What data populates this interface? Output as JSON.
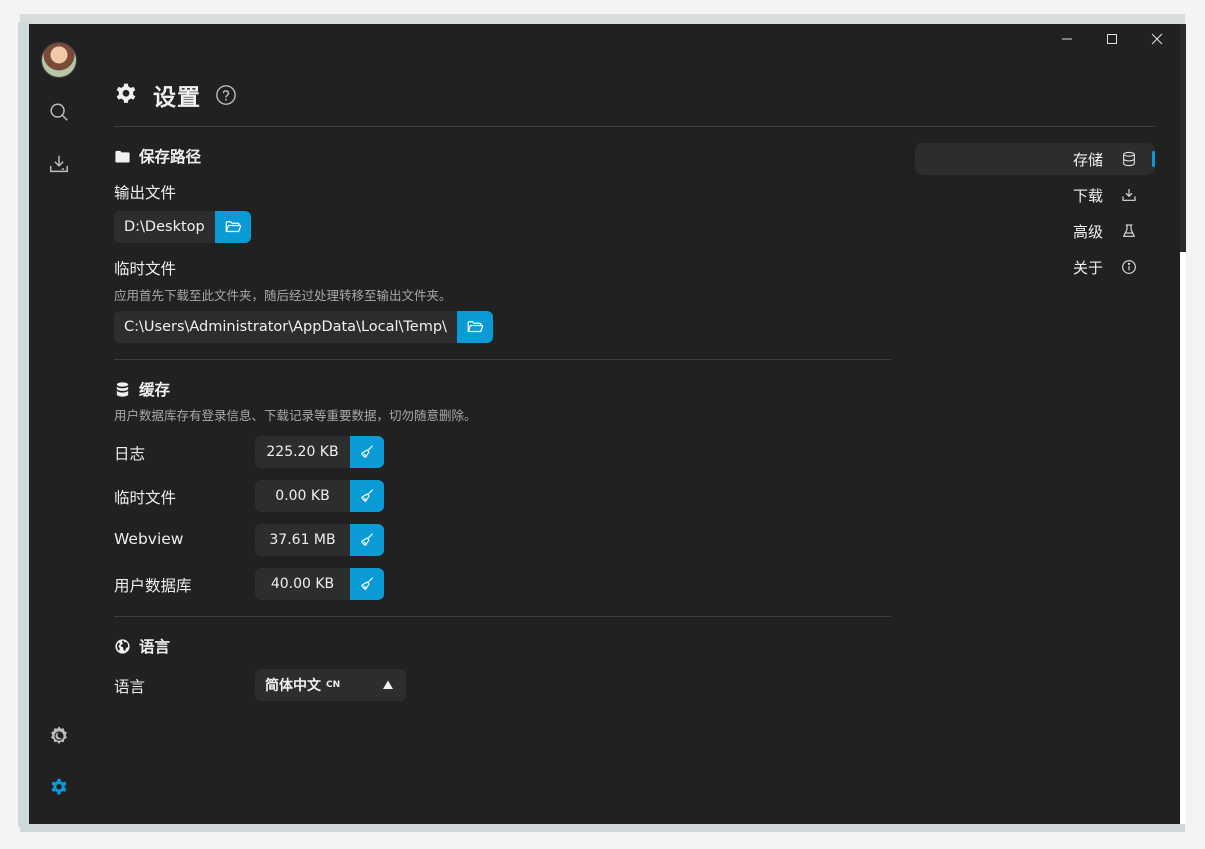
{
  "window": {
    "controls": [
      "minimize",
      "maximize",
      "close"
    ]
  },
  "rail": {
    "items": [
      "avatar",
      "search-icon",
      "download-icon",
      "theme-icon",
      "settings-icon"
    ]
  },
  "header": {
    "title": "设置"
  },
  "save_path": {
    "section_title": "保存路径",
    "output_label": "输出文件",
    "output_value": "D:\\Desktop",
    "temp_label": "临时文件",
    "temp_desc": "应用首先下载至此文件夹，随后经过处理转移至输出文件夹。",
    "temp_value": "C:\\Users\\Administrator\\AppData\\Local\\Temp\\"
  },
  "cache": {
    "section_title": "缓存",
    "desc": "用户数据库存有登录信息、下载记录等重要数据，切勿随意删除。",
    "rows": [
      {
        "label": "日志",
        "value": "225.20 KB"
      },
      {
        "label": "临时文件",
        "value": "0.00 KB"
      },
      {
        "label": "Webview",
        "value": "37.61 MB"
      },
      {
        "label": "用户数据库",
        "value": "40.00 KB"
      }
    ]
  },
  "language": {
    "section_title": "语言",
    "label": "语言",
    "selected": "简体中文",
    "selected_code": "CN"
  },
  "anchor_nav": {
    "items": [
      {
        "label": "存储",
        "icon": "database-icon",
        "active": true
      },
      {
        "label": "下载",
        "icon": "download-icon",
        "active": false
      },
      {
        "label": "高级",
        "icon": "flask-icon",
        "active": false
      },
      {
        "label": "关于",
        "icon": "info-icon",
        "active": false
      }
    ]
  },
  "colors": {
    "background": "#212121",
    "accent": "#0a9ad6",
    "field": "#2d2d2d"
  }
}
